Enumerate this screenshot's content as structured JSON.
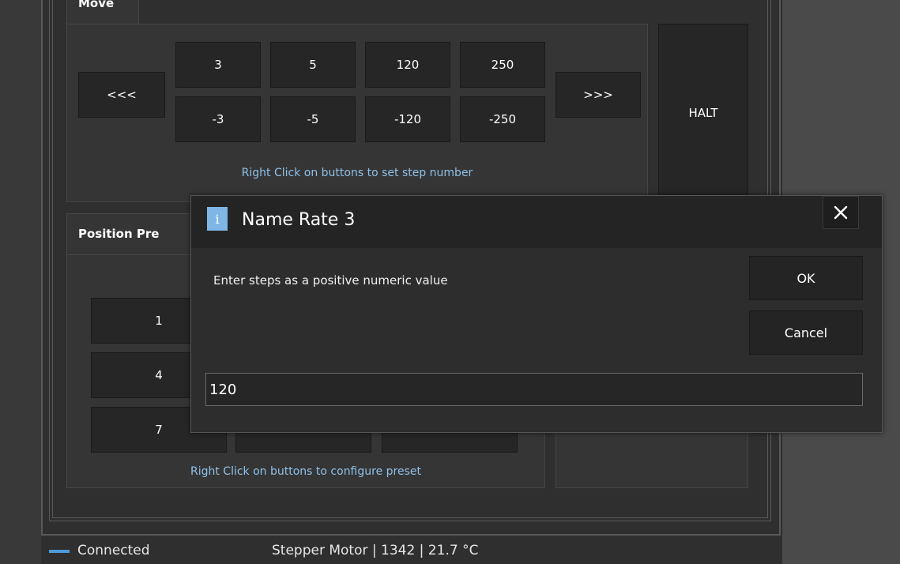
{
  "move": {
    "title": "Move",
    "prev_label": "<<<",
    "next_label": ">>>",
    "steps_pos": [
      "3",
      "5",
      "120",
      "250"
    ],
    "steps_neg": [
      "-3",
      "-5",
      "-120",
      "-250"
    ],
    "hint": "Right Click on buttons to set step number"
  },
  "halt_label": "HALT",
  "presets": {
    "title": "Position Pre",
    "buttons": [
      "1",
      "4",
      "7"
    ],
    "hint": "Right Click on buttons to configure preset"
  },
  "status": {
    "connection": "Connected",
    "info": "Stepper Motor | 1342 | 21.7 °C",
    "led_color": "#4c9ad8"
  },
  "dialog": {
    "icon": "i",
    "title": "Name Rate 3",
    "prompt": "Enter steps as a positive numeric value",
    "ok_label": "OK",
    "cancel_label": "Cancel",
    "value": "120"
  }
}
